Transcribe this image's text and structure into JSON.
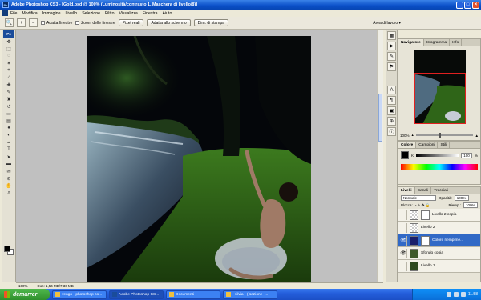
{
  "window": {
    "title": "Adobe Photoshop CS3 - [Gold.psd @ 100% (Luminosità/contrasto 1, Maschera di livello/8)]",
    "minimize": "_",
    "maximize": "□",
    "close": "×"
  },
  "menu": [
    "File",
    "Modifica",
    "Immagine",
    "Livello",
    "Selezione",
    "Filtro",
    "Visualizza",
    "Finestra",
    "Aiuto"
  ],
  "options": {
    "checkbox1": "Adatta finestre",
    "checkbox2": "Zoom delle finestre",
    "btn1": "Pixel reali",
    "btn2": "Adatta allo schermo",
    "btn3": "Dim. di stampa",
    "workspace": "Area di lavoro ▾"
  },
  "toolbox": {
    "badge": "Ps"
  },
  "status": {
    "zoom": "100%",
    "doc": "Doc: 1,54 MB/7,36 MB"
  },
  "navigator": {
    "tabs": [
      "Navigatore",
      "Istogramma",
      "Info"
    ],
    "zoom": "100%"
  },
  "color": {
    "tabs": [
      "Colore",
      "Campioni",
      "Stili"
    ],
    "label": "K",
    "value": "100",
    "unit": "%"
  },
  "layers": {
    "tabs": [
      "Livelli",
      "Canali",
      "Tracciati"
    ],
    "blend": "Normale",
    "opacity_label": "Opacità:",
    "opacity": "100%",
    "lock_label": "Blocca:",
    "fill_label": "Riemp.:",
    "fill": "100%",
    "items": [
      {
        "name": "Livello 2 copia"
      },
      {
        "name": "Livello 2"
      },
      {
        "name": "Colore riempime..."
      },
      {
        "name": "Sfondo copia"
      },
      {
        "name": "Livello 1"
      }
    ]
  },
  "taskbar": {
    "start": "demarrer",
    "tasks": [
      "vengo - photoshop co...",
      "Adobe Photoshop CS...",
      "Documenti",
      "- silvia - ( sezione -..."
    ],
    "clock": "11.58"
  },
  "colors": {
    "accent": "#245edb",
    "titlebar": "#0a4fc8",
    "selection": "#3169c6"
  }
}
